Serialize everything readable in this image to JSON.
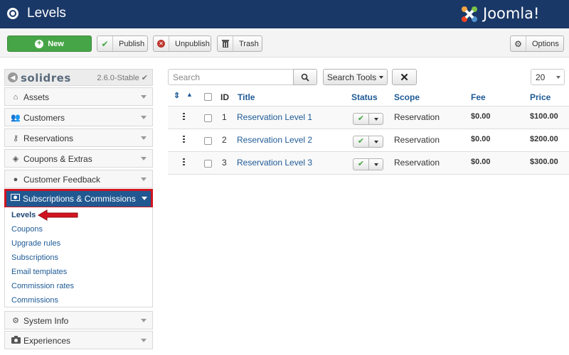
{
  "header": {
    "title": "Levels",
    "logo_text": "Joomla!"
  },
  "toolbar": {
    "new_label": "New",
    "publish_label": "Publish",
    "unpublish_label": "Unpublish",
    "trash_label": "Trash",
    "options_label": "Options"
  },
  "sidebar": {
    "brand": "solidres",
    "version": "2.6.0-Stable",
    "items": [
      {
        "label": "Assets",
        "icon": "home-icon"
      },
      {
        "label": "Customers",
        "icon": "users-icon"
      },
      {
        "label": "Reservations",
        "icon": "key-icon"
      },
      {
        "label": "Coupons & Extras",
        "icon": "tag-icon"
      },
      {
        "label": "Customer Feedback",
        "icon": "comment-icon"
      },
      {
        "label": "Subscriptions & Commissions",
        "icon": "money-icon",
        "active": true
      },
      {
        "label": "System Info",
        "icon": "cog-icon"
      },
      {
        "label": "Experiences",
        "icon": "camera-icon"
      }
    ],
    "submenu": [
      "Levels",
      "Coupons",
      "Upgrade rules",
      "Subscriptions",
      "Email templates",
      "Commission rates",
      "Commissions"
    ]
  },
  "filters": {
    "search_placeholder": "Search",
    "search_tools_label": "Search Tools",
    "limit": "20"
  },
  "table": {
    "headers": {
      "id": "ID",
      "title": "Title",
      "status": "Status",
      "scope": "Scope",
      "fee": "Fee",
      "price": "Price"
    },
    "rows": [
      {
        "id": "1",
        "title": "Reservation Level 1",
        "published": true,
        "scope": "Reservation",
        "fee": "$0.00",
        "price": "$100.00"
      },
      {
        "id": "2",
        "title": "Reservation Level 2",
        "published": true,
        "scope": "Reservation",
        "fee": "$0.00",
        "price": "$200.00"
      },
      {
        "id": "3",
        "title": "Reservation Level 3",
        "published": true,
        "scope": "Reservation",
        "fee": "$0.00",
        "price": "$300.00"
      }
    ]
  },
  "colors": {
    "header_bg": "#1a3867",
    "new_button": "#46a546",
    "active_menu": "#215891",
    "highlight": "#d2141f",
    "link": "#1e5a96"
  }
}
